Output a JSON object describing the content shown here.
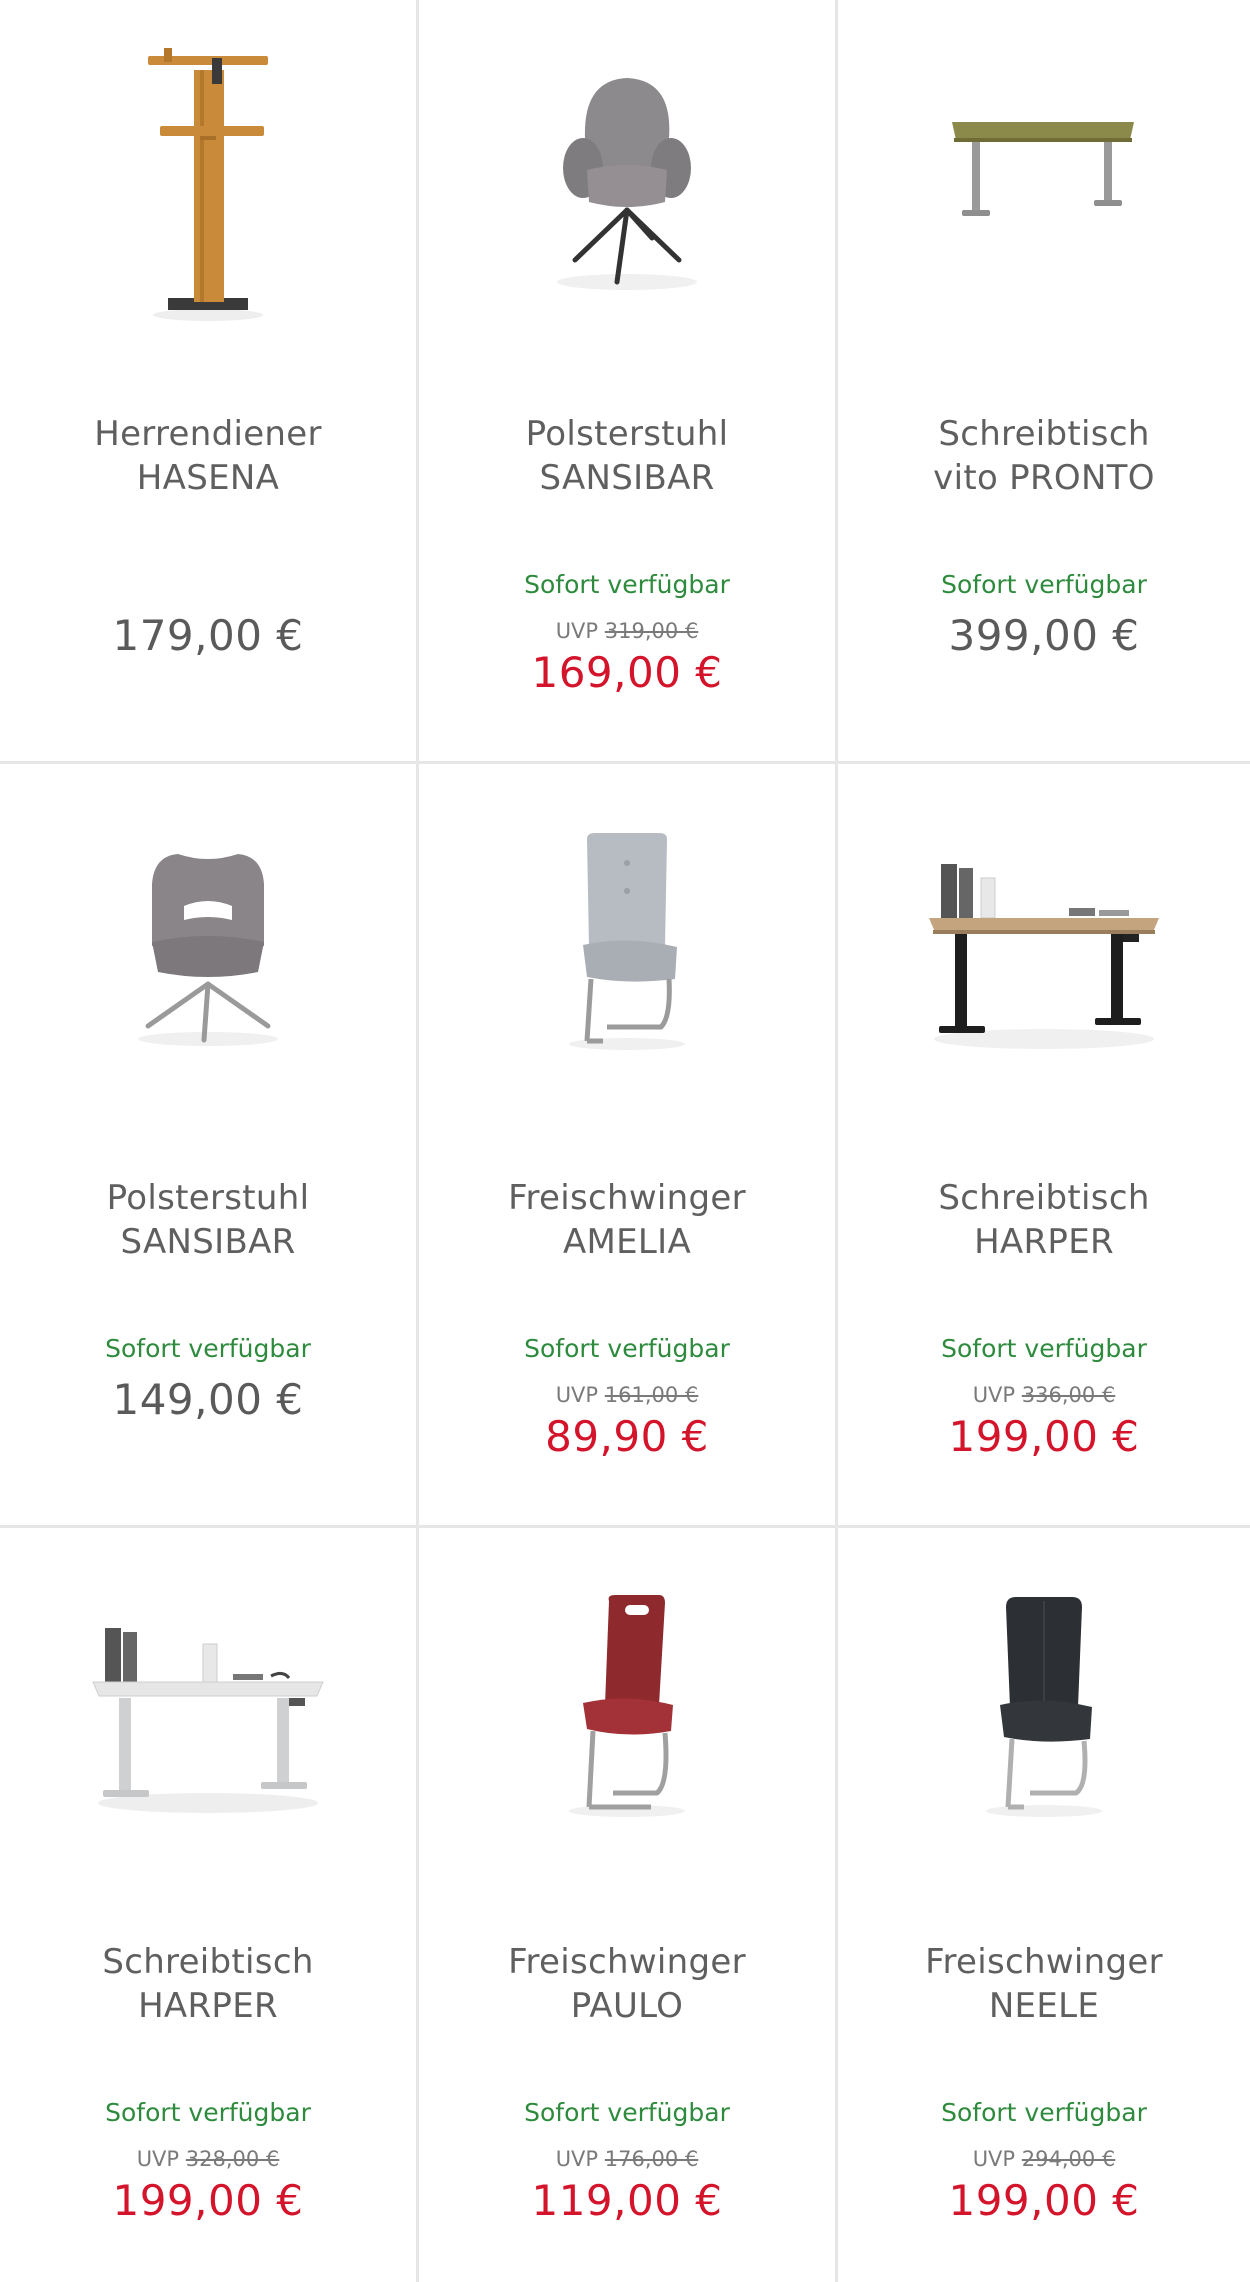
{
  "products": [
    {
      "category": "Herrendiener",
      "name": "HASENA",
      "availability": "",
      "uvp_label": "",
      "uvp_price": "",
      "price": "179,00 €",
      "on_sale": false,
      "image_icon": "valet-stand-icon"
    },
    {
      "category": "Polsterstuhl",
      "name": "SANSIBAR",
      "availability": "Sofort verfügbar",
      "uvp_label": "UVP",
      "uvp_price": "319,00 €",
      "price": "169,00 €",
      "on_sale": true,
      "image_icon": "armchair-icon"
    },
    {
      "category": "Schreibtisch",
      "name": "vito PRONTO",
      "availability": "Sofort verfügbar",
      "uvp_label": "",
      "uvp_price": "",
      "price": "399,00 €",
      "on_sale": false,
      "image_icon": "desk-icon"
    },
    {
      "category": "Polsterstuhl",
      "name": "SANSIBAR",
      "availability": "Sofort verfügbar",
      "uvp_label": "",
      "uvp_price": "",
      "price": "149,00 €",
      "on_sale": false,
      "image_icon": "armchair-icon"
    },
    {
      "category": "Freischwinger",
      "name": "AMELIA",
      "availability": "Sofort verfügbar",
      "uvp_label": "UVP",
      "uvp_price": "161,00 €",
      "price": "89,90 €",
      "on_sale": true,
      "image_icon": "cantilever-chair-icon"
    },
    {
      "category": "Schreibtisch",
      "name": "HARPER",
      "availability": "Sofort verfügbar",
      "uvp_label": "UVP",
      "uvp_price": "336,00 €",
      "price": "199,00 €",
      "on_sale": true,
      "image_icon": "desk-icon"
    },
    {
      "category": "Schreibtisch",
      "name": "HARPER",
      "availability": "Sofort verfügbar",
      "uvp_label": "UVP",
      "uvp_price": "328,00 €",
      "price": "199,00 €",
      "on_sale": true,
      "image_icon": "desk-icon"
    },
    {
      "category": "Freischwinger",
      "name": "PAULO",
      "availability": "Sofort verfügbar",
      "uvp_label": "UVP",
      "uvp_price": "176,00 €",
      "price": "119,00 €",
      "on_sale": true,
      "image_icon": "cantilever-chair-icon"
    },
    {
      "category": "Freischwinger",
      "name": "NEELE",
      "availability": "Sofort verfügbar",
      "uvp_label": "UVP",
      "uvp_price": "294,00 €",
      "price": "199,00 €",
      "on_sale": true,
      "image_icon": "cantilever-chair-icon"
    }
  ],
  "colors": {
    "availability": "#2e8b3d",
    "sale_price": "#d3142a",
    "regular_price": "#5a5a5a",
    "title": "#5f5f5f",
    "divider": "#e6e6e6"
  }
}
